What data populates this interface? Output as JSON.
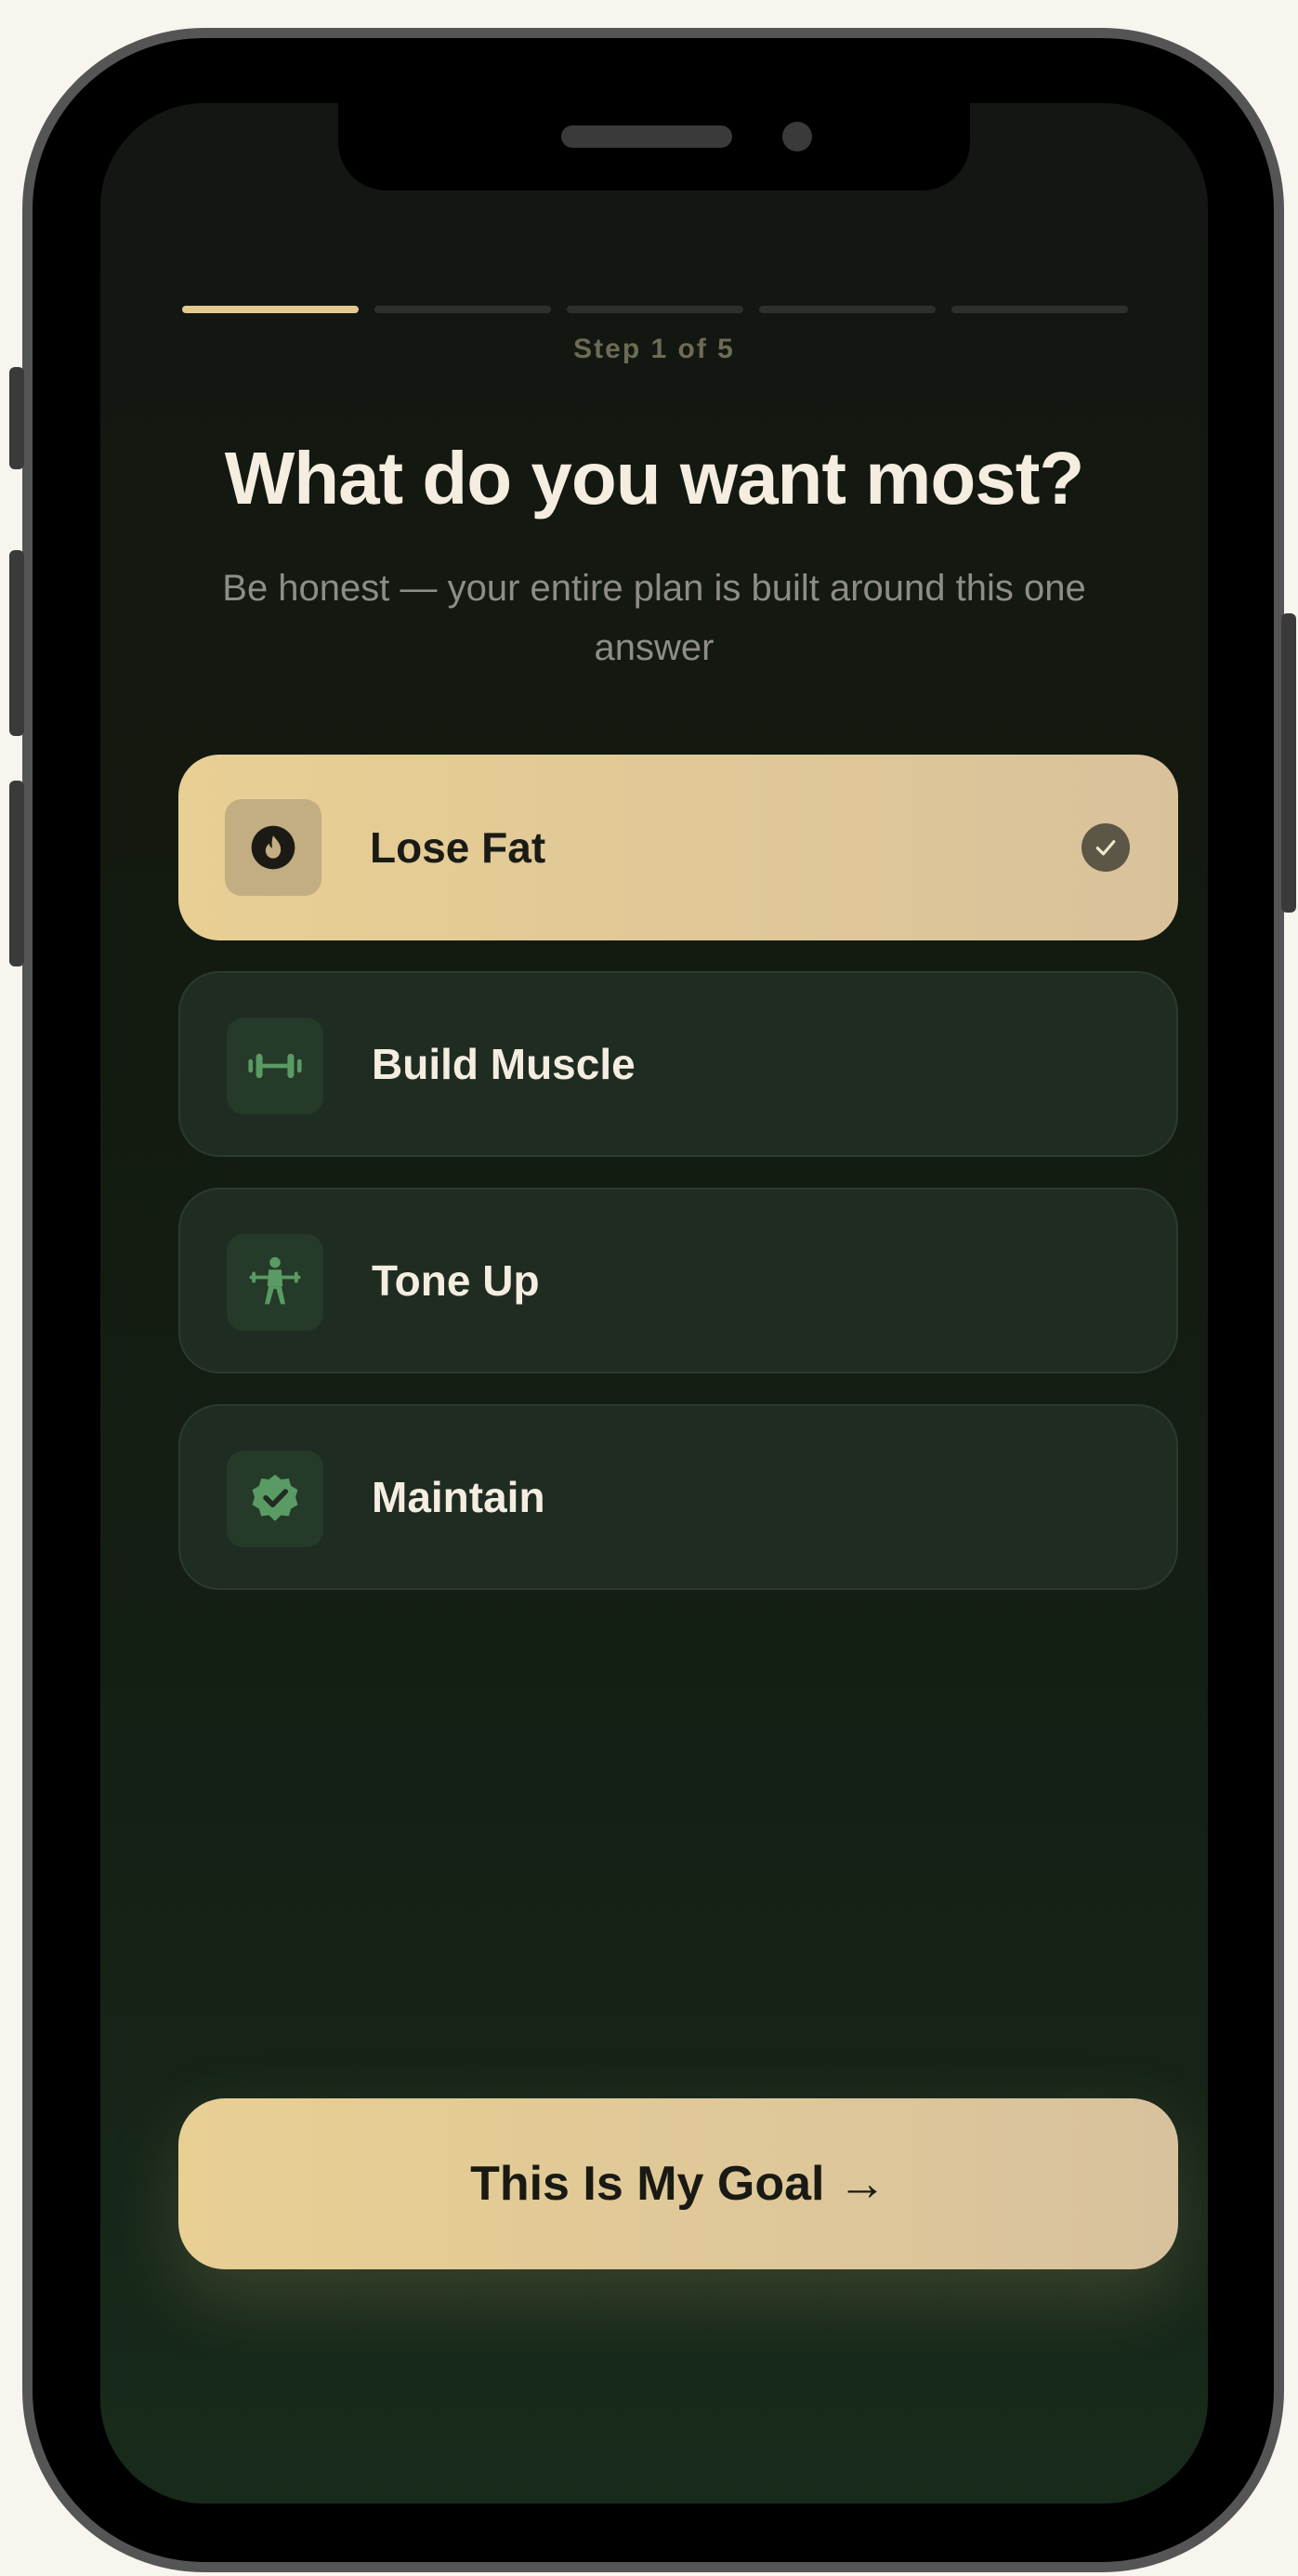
{
  "progress": {
    "total_steps": 5,
    "current_step": 1,
    "label": "Step 1 of 5"
  },
  "header": {
    "title": "What do you want most?",
    "subtitle": "Be honest — your entire plan is built around this one answer"
  },
  "options": [
    {
      "label": "Lose Fat",
      "icon": "flame-icon",
      "selected": true
    },
    {
      "label": "Build Muscle",
      "icon": "dumbbell-icon",
      "selected": false
    },
    {
      "label": "Tone Up",
      "icon": "weightlifter-icon",
      "selected": false
    },
    {
      "label": "Maintain",
      "icon": "verified-badge-icon",
      "selected": false
    }
  ],
  "cta": {
    "label": "This Is My Goal →"
  },
  "colors": {
    "accent": "#e3c98f",
    "background": "#13190f",
    "card": "#1f2c22",
    "icon_green": "#5a9a63",
    "text_primary": "#f4ede0",
    "text_muted": "#8d8d86"
  }
}
